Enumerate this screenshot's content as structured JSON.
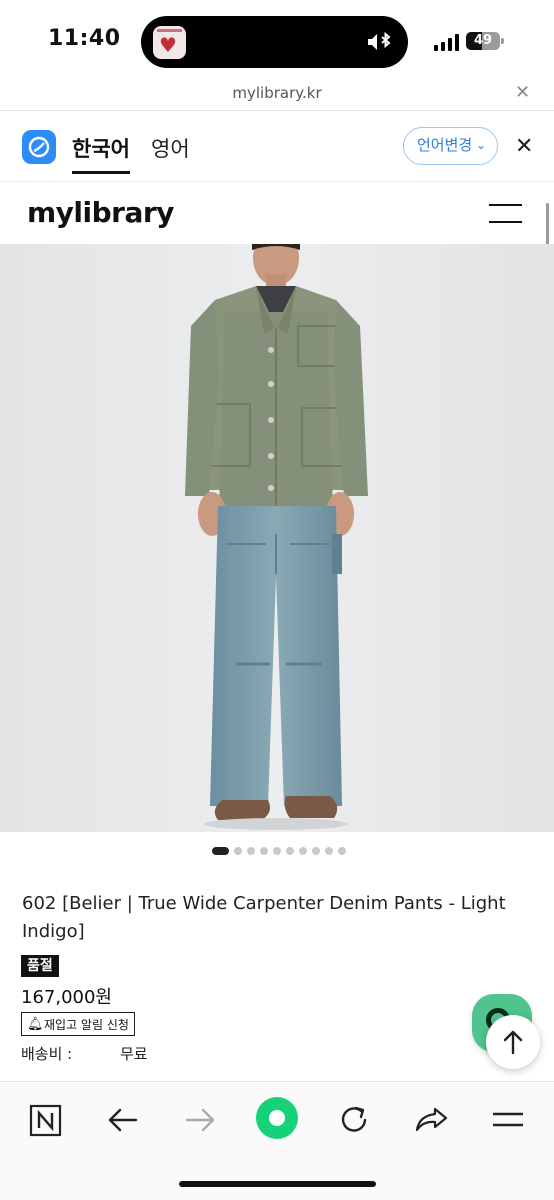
{
  "status_bar": {
    "time": "11:40",
    "battery": "49"
  },
  "url_bar": {
    "domain": "mylibrary.kr"
  },
  "translate_bar": {
    "tab_korean": "한국어",
    "tab_english": "영어",
    "change_language": "언어변경",
    "change_language_chevron": "⌄"
  },
  "site": {
    "logo": "mylibrary"
  },
  "carousel": {
    "total": 10,
    "active_index": 0
  },
  "product": {
    "title": "602 [Belier | True Wide Carpenter Denim Pants - Light Indigo]",
    "badge": "품절",
    "price": "167,000원",
    "restock_button": "재입고 알림 신청",
    "shipping_label": "배송비 :",
    "shipping_value": "무료"
  },
  "colors": {
    "accent_blue": "#2d7fe3",
    "reload_green": "#15d27a",
    "chat_green": "#4fc48c"
  }
}
